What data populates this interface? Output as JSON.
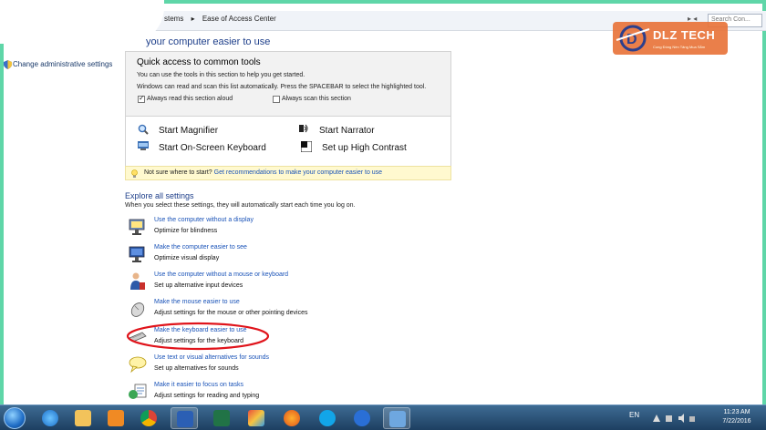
{
  "window": {
    "breadcrumb": [
      "stems",
      "Ease of Access Center"
    ],
    "search_placeholder": "Search Con...",
    "nav_arrow": "▸ ◂"
  },
  "logo": {
    "text": "DLZ TECH",
    "tagline": "Cung Đồng Nền Tảng Mua Sắm"
  },
  "left_nav": {
    "link": "Change administrative settings"
  },
  "page": {
    "heading": "your computer easier to use"
  },
  "quick_access": {
    "title": "Quick access to common tools",
    "line1": "You can use the tools in this section to help you get started.",
    "line2": "Windows can read and scan this list automatically.  Press the SPACEBAR to select the highlighted tool.",
    "check_read": "Always read this section aloud",
    "check_scan": "Always scan this section",
    "tools": {
      "magnifier": "Start Magnifier",
      "narrator": "Start Narrator",
      "osk": "Start On-Screen Keyboard",
      "contrast": "Set up High Contrast"
    }
  },
  "hint": {
    "prefix": "Not sure where to start?",
    "link": "Get recommendations to make your computer easier to use"
  },
  "explore": {
    "title": "Explore all settings",
    "desc": "When you select these settings, they will automatically start each time you log on.",
    "items": [
      {
        "link": "Use the computer without a display",
        "desc": "Optimize for blindness",
        "icon": "display-icon"
      },
      {
        "link": "Make the computer easier to see",
        "desc": "Optimize visual display",
        "icon": "monitor-icon"
      },
      {
        "link": "Use the computer without a mouse or keyboard",
        "desc": "Set up alternative input devices",
        "icon": "person-icon"
      },
      {
        "link": "Make the mouse easier to use",
        "desc": "Adjust settings for the mouse or other pointing devices",
        "icon": "mouse-icon"
      },
      {
        "link": "Make the keyboard easier to use",
        "desc": "Adjust settings for the keyboard",
        "icon": "keyboard-icon"
      },
      {
        "link": "Use text or visual alternatives for sounds",
        "desc": "Set up alternatives for sounds",
        "icon": "speech-bubble-icon"
      },
      {
        "link": "Make it easier to focus on tasks",
        "desc": "Adjust settings for reading and typing",
        "icon": "tasks-icon"
      }
    ]
  },
  "taskbar": {
    "language": "EN",
    "time": "11:23 AM",
    "date": "7/22/2016",
    "apps": [
      "ie-icon",
      "folder-icon",
      "media-player-icon",
      "chrome-icon",
      "word-icon",
      "excel-icon",
      "paint-icon",
      "firefox-icon",
      "skype-icon",
      "help-icon",
      "control-panel-icon"
    ]
  },
  "colors": {
    "link": "#1a53b8",
    "heading": "#1e3f8a",
    "annotation": "#e0141b",
    "taskbar": "#2a5279",
    "frame": "#5fd6a8",
    "logo": "#e8743b"
  }
}
